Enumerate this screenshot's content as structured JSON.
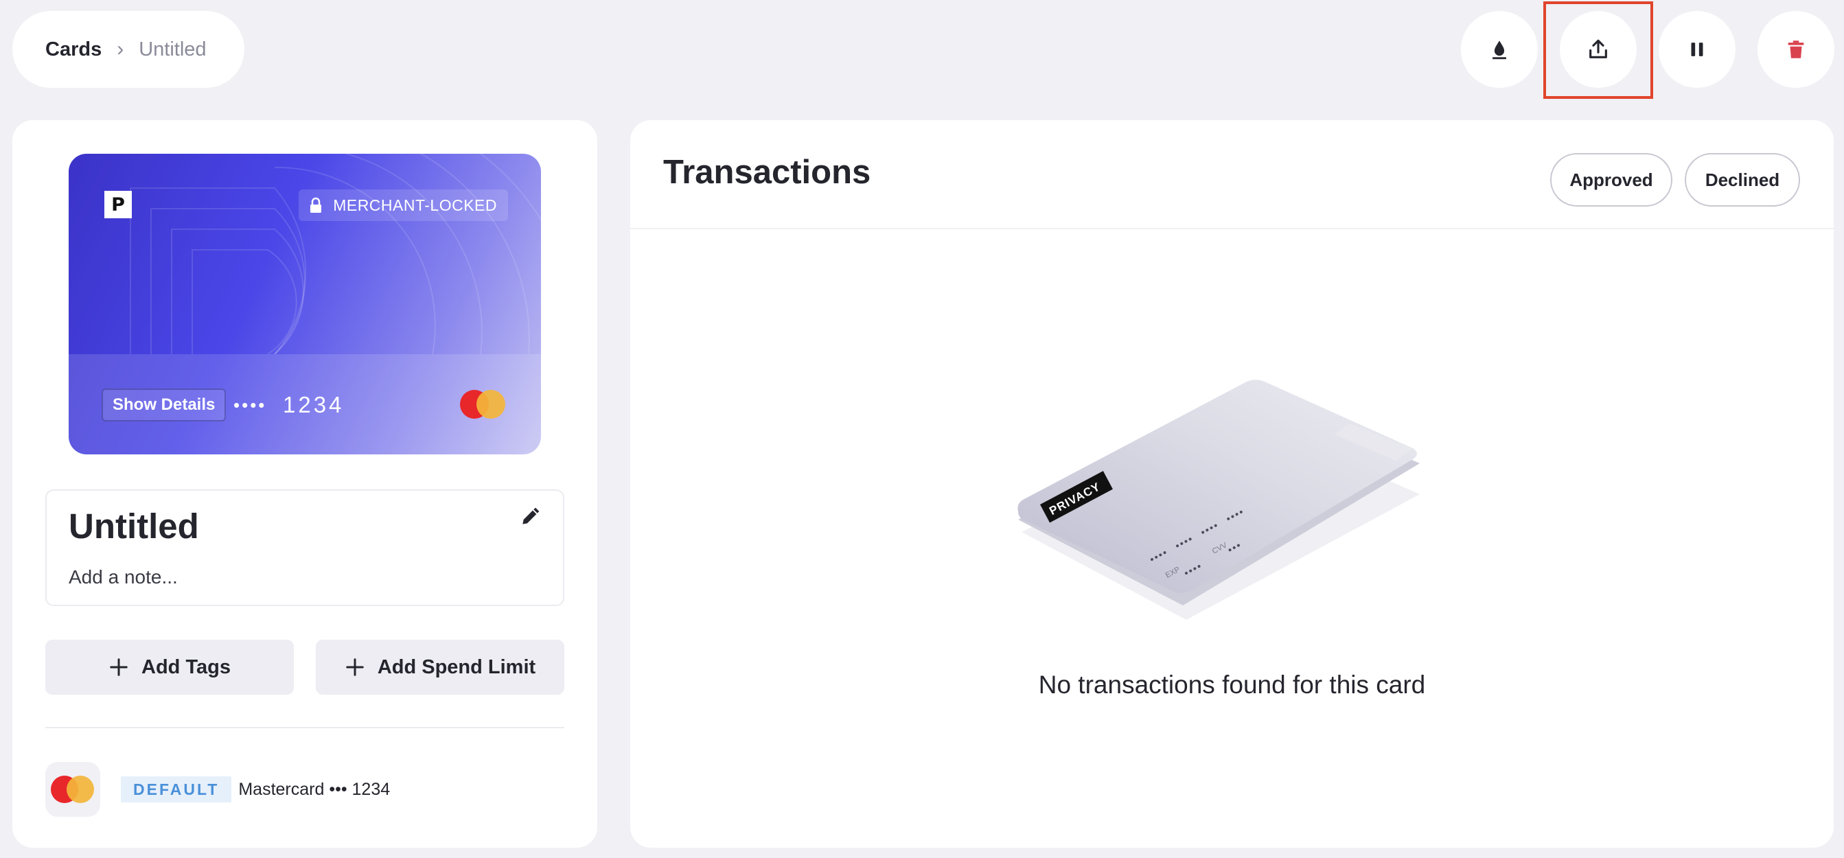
{
  "breadcrumb": {
    "root": "Cards",
    "separator": "›",
    "current": "Untitled"
  },
  "actions": [
    {
      "name": "fund-button",
      "icon": "drop-icon"
    },
    {
      "name": "share-button",
      "icon": "upload-icon"
    },
    {
      "name": "pause-button",
      "icon": "pause-icon"
    },
    {
      "name": "delete-button",
      "icon": "trash-icon"
    }
  ],
  "card": {
    "logo_letter": "P",
    "lock_badge": "MERCHANT-LOCKED",
    "show_details_label": "Show Details",
    "masked_dots": "••••",
    "last4": "1234",
    "network_icon": "mastercard-logo",
    "name": "Untitled",
    "note_placeholder": "Add a note..."
  },
  "buttons": {
    "add_tags": "Add Tags",
    "add_spend_limit": "Add Spend Limit"
  },
  "payment_method": {
    "badge": "DEFAULT",
    "label": "Mastercard ••• 1234"
  },
  "transactions": {
    "title": "Transactions",
    "filters": [
      "Approved",
      "Declined"
    ],
    "empty_message": "No transactions found for this card",
    "illustration_label": "PRIVACY",
    "illustration_exp": "EXP",
    "illustration_cvv": "CVV"
  },
  "colors": {
    "background": "#f0f0f5",
    "card_gradient_start": "#3b33c8",
    "card_gradient_end": "#c6c4f2",
    "delete_red": "#d9414e",
    "highlight": "#e0452c",
    "default_badge": "#4a90d9"
  }
}
